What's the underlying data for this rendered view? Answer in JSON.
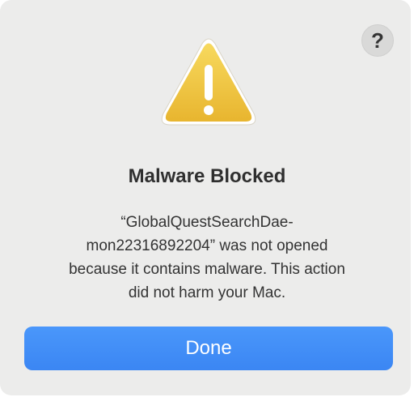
{
  "dialog": {
    "help_button_label": "?",
    "icon": "warning-triangle-icon",
    "title": "Malware Blocked",
    "message_lines": [
      "“GlobalQuestSearchDae-",
      "mon22316892204” was not opened",
      "because it contains malware. This action",
      "did not harm your Mac."
    ],
    "done_button_label": "Done"
  },
  "colors": {
    "background": "#ececeb",
    "accent_button": "#3b86f3",
    "warning_yellow": "#f2c94c",
    "warning_symbol": "#ffffff"
  }
}
